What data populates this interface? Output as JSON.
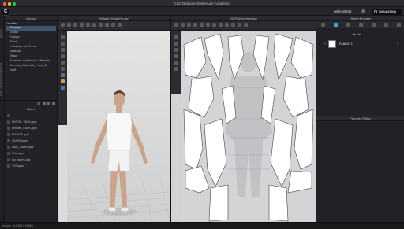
{
  "window": {
    "title": "CLO Network OnlineAuth Academic"
  },
  "header": {
    "user": "nelly.amhal",
    "mode": "SIMULATION"
  },
  "vertical_tabs": [
    "LIBRARY",
    "MODULAR CONFIGURATOR"
  ],
  "library": {
    "title": "Library",
    "favorites_label": "Favorites",
    "folders": [
      "Garment",
      "Avatar",
      "Hanger",
      "Fabric",
      "Hardware and Trims",
      "Material",
      "Stage",
      "Exercise-1_Materials & Presets",
      "Exercise_Materials_Prints_Gr",
      "stuff"
    ],
    "selected_folder": 0,
    "name_header": "Name",
    "files": [
      "..",
      "DIGITAL TWIN.zpac",
      "Female_T-shirt.zpac",
      "HOODIE.zpac",
      "JEANS.zpac",
      "Male_T-shirt.zpac",
      "Rob.zpac",
      "top drapes.png",
      "TOP.zpac"
    ]
  },
  "window3d": {
    "title": "Default_Model(ti).zprj"
  },
  "window2d": {
    "title": "2D Pattern Window"
  },
  "object_browser": {
    "title": "Object Browser",
    "add_label": "Add",
    "fabric": {
      "name": "FABRIC 1",
      "checked": true
    }
  },
  "property_editor": {
    "title": "Property Editor"
  },
  "status": {
    "version": "Version : 6.2.360 (r42986)"
  },
  "colors": {
    "accent": "#4da3e0",
    "selection": "#3d5470",
    "pattern_fill": "#ffffff",
    "background": "#1b1b1e"
  },
  "icons": [
    "close-dot",
    "minimize-dot",
    "maximize-dot",
    "user-icon",
    "simulation-icon",
    "check-icon",
    "close-icon",
    "search-icon",
    "folder-icon",
    "file-icon"
  ]
}
